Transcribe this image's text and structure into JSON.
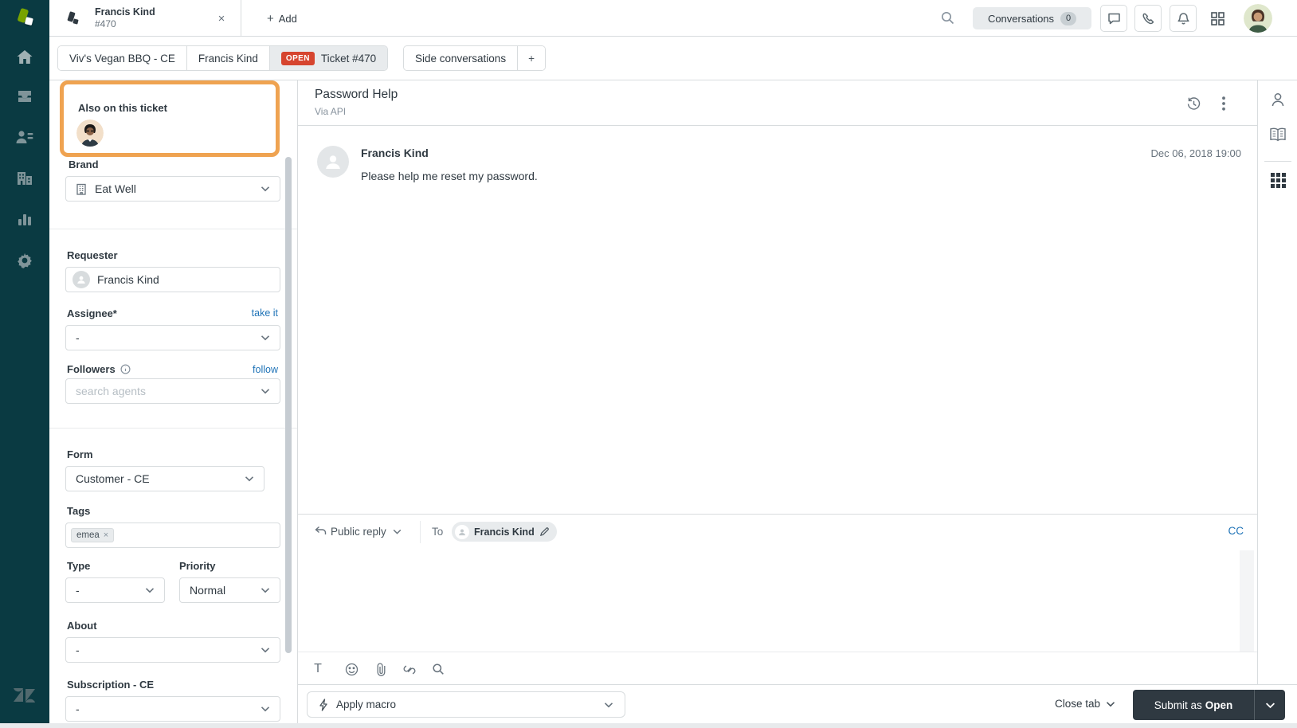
{
  "colors": {
    "nav_background": "#0a3a42",
    "brand_green": "#78a300",
    "highlight_orange": "#efa351",
    "open_status_red": "#d6452f",
    "link_blue": "#1f73b7",
    "submit_dark": "#2f3941"
  },
  "nav": {
    "items": [
      "home",
      "views",
      "customers",
      "organizations",
      "reporting",
      "admin"
    ]
  },
  "topbar": {
    "tab_title": "Francis Kind",
    "tab_subtitle": "#470",
    "close_glyph": "×",
    "plus_glyph": "+",
    "add_label": "Add",
    "conversations_label": "Conversations",
    "conversations_count": "0"
  },
  "breadcrumbs": {
    "brand": "Viv's Vegan BBQ - CE",
    "requester": "Francis Kind",
    "status_badge": "OPEN",
    "ticket": "Ticket #470",
    "side_conversations": "Side conversations",
    "add_glyph": "+"
  },
  "sidebar": {
    "also_on_ticket_label": "Also on this ticket",
    "brand_label": "Brand",
    "brand_value": "Eat Well",
    "requester_label": "Requester",
    "requester_value": "Francis Kind",
    "assignee_label": "Assignee*",
    "take_it_link": "take it",
    "assignee_value": "-",
    "followers_label": "Followers",
    "follow_link": "follow",
    "followers_placeholder": "search agents",
    "form_label": "Form",
    "form_value": "Customer - CE",
    "tags_label": "Tags",
    "tags": [
      "emea"
    ],
    "tag_dismiss_glyph": "×",
    "type_label": "Type",
    "type_value": "-",
    "priority_label": "Priority",
    "priority_value": "Normal",
    "about_label": "About",
    "about_value": "-",
    "subscription_label": "Subscription - CE",
    "subscription_value": "-"
  },
  "conversation": {
    "title": "Password Help",
    "via": "Via API",
    "message_author": "Francis Kind",
    "message_timestamp": "Dec 06, 2018 19:00",
    "message_body": "Please help me reset my password."
  },
  "composer": {
    "reply_type": "Public reply",
    "to_label": "To",
    "recipient": "Francis Kind",
    "cc_label": "CC",
    "format_glyph": "T"
  },
  "footer": {
    "apply_macro_label": "Apply macro",
    "close_tab_label": "Close tab",
    "submit_prefix": "Submit as",
    "submit_status": "Open"
  },
  "icons": {
    "topbar": [
      "search-icon",
      "chat-icon",
      "phone-icon",
      "bell-icon",
      "grid-icon"
    ],
    "conversation_header": [
      "history-icon",
      "kebab-icon"
    ],
    "composer_toolbar": [
      "text-format-icon",
      "emoji-icon",
      "attachment-icon",
      "link-icon",
      "search-icon"
    ],
    "right_sidebar": [
      "user-icon",
      "knowledge-icon",
      "apps-grid-icon"
    ]
  }
}
